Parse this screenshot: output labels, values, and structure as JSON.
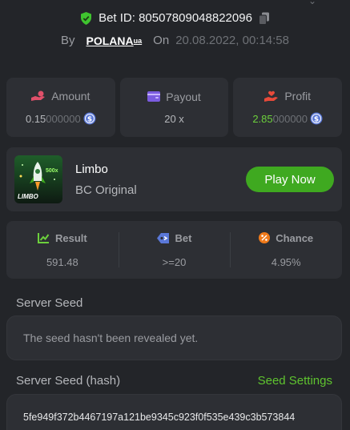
{
  "header": {
    "bet_label": "Bet ID:",
    "bet_id": "80507809048822096",
    "by_label": "By",
    "username": "POLANA",
    "username_suffix": "ua",
    "on_label": "On",
    "date": "20.08.2022, 00:14:58"
  },
  "stats": {
    "amount": {
      "label": "Amount",
      "value_main": "0.15",
      "value_dim": "000000"
    },
    "payout": {
      "label": "Payout",
      "value": "20 x"
    },
    "profit": {
      "label": "Profit",
      "value_main": "2.85",
      "value_dim": "000000"
    }
  },
  "game": {
    "name": "Limbo",
    "provider": "BC Original",
    "play_label": "Play Now",
    "thumb_text": "LIMBO",
    "thumb_badge": "500x"
  },
  "result": {
    "result": {
      "label": "Result",
      "value": "591.48"
    },
    "bet": {
      "label": "Bet",
      "value": ">=20"
    },
    "chance": {
      "label": "Chance",
      "value": "4.95%"
    }
  },
  "server_seed": {
    "label": "Server Seed",
    "value": "The seed hasn't been revealed yet."
  },
  "server_seed_hash": {
    "label": "Server Seed (hash)",
    "settings_label": "Seed Settings",
    "value": "5fe949f372b4467197a121be9345c923f0f535e439c3b573844"
  },
  "colors": {
    "accent_green": "#3fa920",
    "profit_green": "#6cd03c",
    "coin_blue": "#5a78d8",
    "background": "#232529",
    "card": "#2d2f34"
  },
  "icons": {
    "verified": "shield-check-icon",
    "copy": "copy-icon",
    "amount": "hand-coin-icon",
    "payout": "wallet-icon",
    "profit": "hand-heart-icon",
    "coin": "coin-icon",
    "result": "chart-icon",
    "bet": "tag-icon",
    "chance": "percent-icon"
  }
}
